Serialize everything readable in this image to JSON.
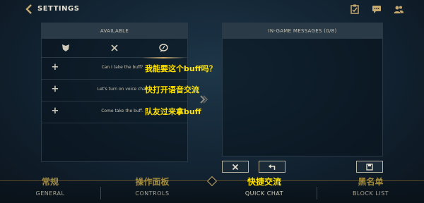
{
  "header": {
    "title": "SETTINGS",
    "icons": [
      "back-chevron-icon",
      "checklist-icon",
      "chat-icon",
      "friends-icon"
    ]
  },
  "available": {
    "heading": "AVAILABLE",
    "tabs": [
      {
        "icon": "shield-icon",
        "active": false
      },
      {
        "icon": "crossed-swords-icon",
        "active": false
      },
      {
        "icon": "speech-bubble-icon",
        "active": true
      }
    ],
    "messages": [
      {
        "text": "Can I take the buff?",
        "annotation": "我能要这个buff吗？"
      },
      {
        "text": "Let's turn on voice chat",
        "annotation": "快打开语音交流"
      },
      {
        "text": "Come take the buff.",
        "annotation": "队友过来拿buff"
      }
    ]
  },
  "ingame": {
    "heading": "IN-GAME MESSAGES (0/8)",
    "buttons": [
      "clear-icon",
      "undo-icon",
      "save-icon"
    ]
  },
  "nav": [
    {
      "cn": "常规",
      "en": "GENERAL",
      "active": false
    },
    {
      "cn": "操作面板",
      "en": "CONTROLS",
      "active": false
    },
    {
      "cn": "快捷交流",
      "en": "QUICK CHAT",
      "active": true
    },
    {
      "cn": "黑名单",
      "en": "BLOCK LIST",
      "active": false
    }
  ],
  "colors": {
    "accent": "#c8aa6e",
    "annotation": "#ffe100",
    "panel_header": "#2a3a47"
  }
}
